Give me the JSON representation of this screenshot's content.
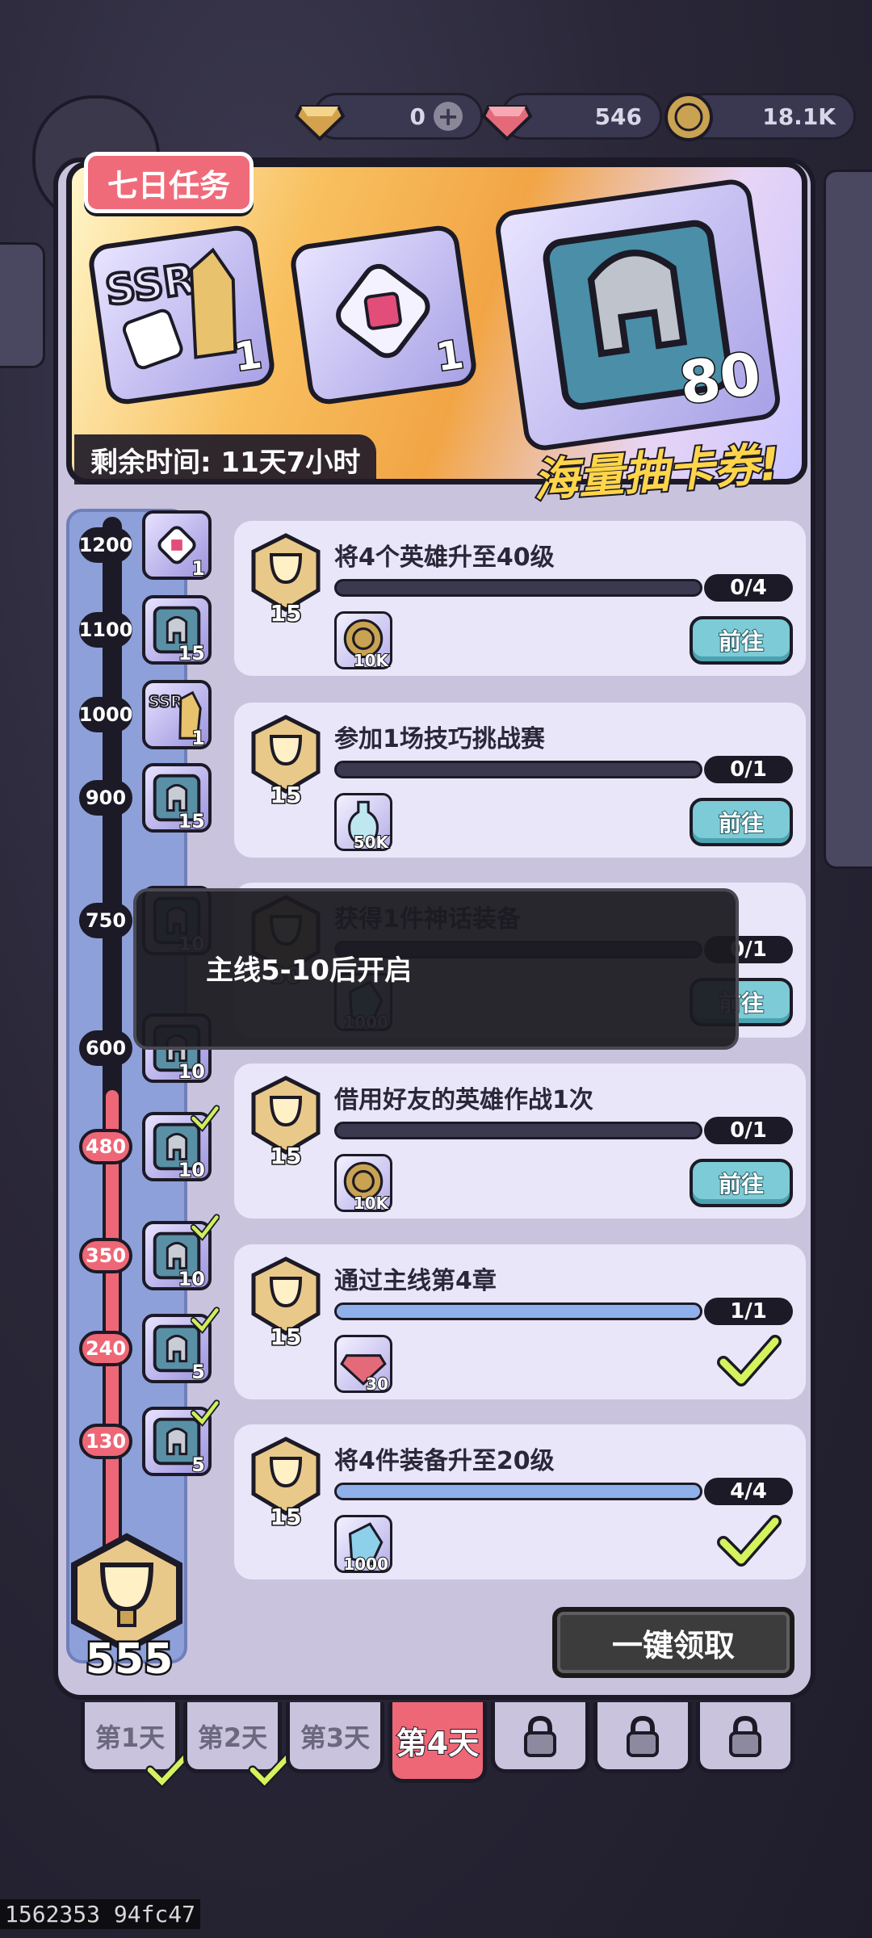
{
  "currency": [
    {
      "icon": "gold-gem-icon",
      "value": "0"
    },
    {
      "icon": "ruby-icon",
      "value": "546"
    },
    {
      "icon": "coin-icon",
      "value": "18.1K"
    }
  ],
  "banner": {
    "title": "七日任务",
    "rewards": [
      {
        "icon": "ssr-hero-dice-icon",
        "count": "1"
      },
      {
        "icon": "rune-crystal-icon",
        "count": "1"
      },
      {
        "icon": "helmet-book-icon",
        "count": "80"
      }
    ],
    "time_label": "剩余时间: 11天7小时",
    "slogan": "海量抽卡券!"
  },
  "milestones": [
    {
      "points": "1200",
      "reward_icon": "rune-crystal-icon",
      "count": "1",
      "claimed": false
    },
    {
      "points": "1100",
      "reward_icon": "helmet-book-icon",
      "count": "15",
      "claimed": false
    },
    {
      "points": "1000",
      "reward_icon": "ssr-hero-dice-icon",
      "count": "1",
      "claimed": false
    },
    {
      "points": "900",
      "reward_icon": "helmet-book-icon",
      "count": "15",
      "claimed": false
    },
    {
      "points": "750",
      "reward_icon": "helmet-book-icon",
      "count": "10",
      "claimed": false
    },
    {
      "points": "600",
      "reward_icon": "helmet-book-icon",
      "count": "10",
      "claimed": false
    },
    {
      "points": "480",
      "reward_icon": "helmet-book-icon",
      "count": "10",
      "claimed": true
    },
    {
      "points": "350",
      "reward_icon": "helmet-book-icon",
      "count": "10",
      "claimed": true
    },
    {
      "points": "240",
      "reward_icon": "helmet-book-icon",
      "count": "5",
      "claimed": true
    },
    {
      "points": "130",
      "reward_icon": "helmet-book-icon",
      "count": "5",
      "claimed": true
    }
  ],
  "tasks": [
    {
      "title": "将4个英雄升至40级",
      "progress": "0/4",
      "fraction": 0,
      "points": "15",
      "reward_icon": "coin-icon",
      "reward_amount": "10K",
      "action": "前往",
      "done": false
    },
    {
      "title": "参加1场技巧挑战赛",
      "progress": "0/1",
      "fraction": 0,
      "points": "15",
      "reward_icon": "potion-bottle-icon",
      "reward_amount": "50K",
      "action": "前往",
      "done": false
    },
    {
      "title": "获得1件神话装备",
      "progress": "0/1",
      "fraction": 0,
      "points": "30",
      "reward_icon": "crystal-shard-icon",
      "reward_amount": "1000",
      "action": "前往",
      "done": false
    },
    {
      "title": "借用好友的英雄作战1次",
      "progress": "0/1",
      "fraction": 0,
      "points": "15",
      "reward_icon": "coin-icon",
      "reward_amount": "10K",
      "action": "前往",
      "done": false
    },
    {
      "title": "通过主线第4章",
      "progress": "1/1",
      "fraction": 1,
      "points": "15",
      "reward_icon": "ruby-icon",
      "reward_amount": "30",
      "action": "",
      "done": true
    },
    {
      "title": "将4件装备升至20级",
      "progress": "4/4",
      "fraction": 1,
      "points": "15",
      "reward_icon": "crystal-shard-icon",
      "reward_amount": "1000",
      "action": "",
      "done": true
    }
  ],
  "toast": "主线5-10后开启",
  "total_points": "555",
  "claim_all_label": "一键领取",
  "day_tabs": [
    {
      "label": "第1天",
      "state": "done"
    },
    {
      "label": "第2天",
      "state": "done"
    },
    {
      "label": "第3天",
      "state": "normal"
    },
    {
      "label": "第4天",
      "state": "active"
    },
    {
      "label": "",
      "state": "locked"
    },
    {
      "label": "",
      "state": "locked"
    },
    {
      "label": "",
      "state": "locked"
    }
  ],
  "footer_id": "1562353 94fc47",
  "colors": {
    "accent_red": "#ee6777",
    "button_teal": "#7ccbd6",
    "panel": "#c9c3de",
    "dark": "#1c1a26"
  }
}
